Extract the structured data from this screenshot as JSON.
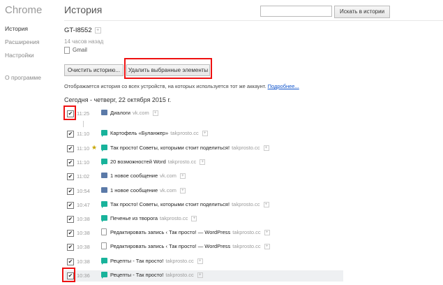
{
  "app": {
    "brand": "Chrome"
  },
  "nav": {
    "history": "История",
    "extensions": "Расширения",
    "settings": "Настройки",
    "about": "О программе"
  },
  "header": {
    "title": "История",
    "search_placeholder": "",
    "search_button": "Искать в истории"
  },
  "device": {
    "name": "GT-I8552",
    "ago": "14 часов назад",
    "tab": "Gmail",
    "plus": "+"
  },
  "toolbar": {
    "clear_label": "Очистить историю...",
    "delete_label": "Удалить выбранные элементы"
  },
  "info": {
    "text": "Отображается история со всех устройств, на которых используется тот же аккаунт. ",
    "link": "Подробнее..."
  },
  "date_header": "Сегодня - четверг, 22 октября 2015 г.",
  "rows": [
    {
      "time": "11:25",
      "title": "Диалоги",
      "domain": "vk.com",
      "icon": "vk",
      "checked": true
    },
    {
      "time": "11:10",
      "title": "Картофель «Буланжер»",
      "domain": "takprosto.cc",
      "icon": "tp",
      "checked": true
    },
    {
      "time": "11:10",
      "title": "Так просто! Советы, которыми стоит поделиться!",
      "domain": "takprosto.cc",
      "icon": "tp",
      "checked": true,
      "star": true
    },
    {
      "time": "11:10",
      "title": "20 возможностей Word",
      "domain": "takprosto.cc",
      "icon": "tp",
      "checked": true
    },
    {
      "time": "11:02",
      "title": "1 новое сообщение",
      "domain": "vk.com",
      "icon": "vk",
      "checked": true
    },
    {
      "time": "10:54",
      "title": "1 новое сообщение",
      "domain": "vk.com",
      "icon": "vk",
      "checked": true
    },
    {
      "time": "10:47",
      "title": "Так просто! Советы, которыми стоит поделиться!",
      "domain": "takprosto.cc",
      "icon": "tp",
      "checked": true
    },
    {
      "time": "10:38",
      "title": "Печенье из творога",
      "domain": "takprosto.cc",
      "icon": "tp",
      "checked": true
    },
    {
      "time": "10:38",
      "title": "Редактировать запись ‹ Так просто! — WordPress",
      "domain": "takprosto.cc",
      "icon": "doc",
      "checked": true
    },
    {
      "time": "10:38",
      "title": "Редактировать запись ‹ Так просто! — WordPress",
      "domain": "takprosto.cc",
      "icon": "doc",
      "checked": true
    },
    {
      "time": "10:38",
      "title": "Рецепты - Так просто!",
      "domain": "takprosto.cc",
      "icon": "tp",
      "checked": true
    },
    {
      "time": "10:36",
      "title": "Рецепты - Так просто!",
      "domain": "takprosto.cc",
      "icon": "tp",
      "checked": true,
      "highlight": true
    }
  ]
}
